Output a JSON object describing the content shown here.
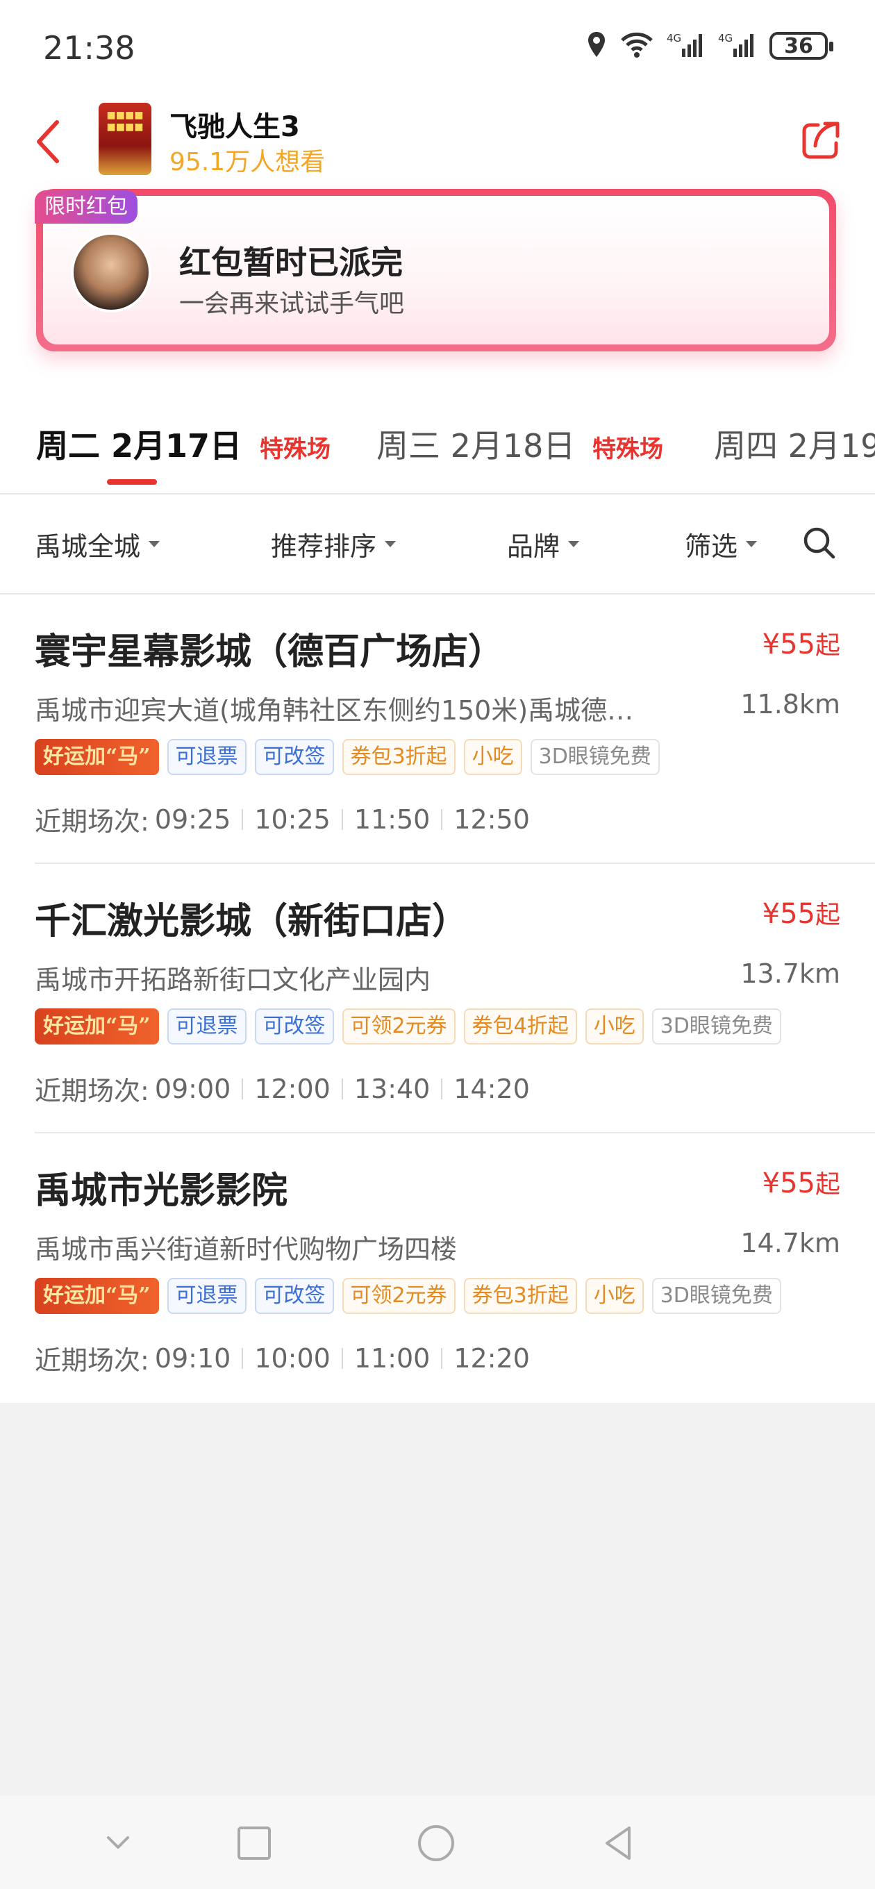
{
  "status_bar": {
    "time": "21:38",
    "battery": "36",
    "icons": [
      "location-icon",
      "wifi-icon",
      "signal-4g-icon",
      "signal-4g-icon",
      "battery-icon"
    ]
  },
  "header": {
    "movie_title": "飞驰人生3",
    "want_count": "95.1万人想看",
    "back_icon": "chevron-left-icon",
    "share_icon": "share-icon",
    "accent_color": "#e8342f"
  },
  "red_packet": {
    "tag": "限时红包",
    "title": "红包暂时已派完",
    "subtitle": "一会再来试试手气吧"
  },
  "date_tabs": [
    {
      "weekday": "周二",
      "date": "2月17日",
      "badge": "特殊场",
      "active": true
    },
    {
      "weekday": "周三",
      "date": "2月18日",
      "badge": "特殊场",
      "active": false
    },
    {
      "weekday": "周四",
      "date": "2月19",
      "badge": "",
      "active": false
    }
  ],
  "filters": {
    "area": "禹城全城",
    "sort": "推荐排序",
    "brand": "品牌",
    "filter": "筛选",
    "search_icon": "search-icon"
  },
  "cinemas": [
    {
      "name": "寰宇星幕影城（德百广场店）",
      "price": "¥55",
      "price_suffix": "起",
      "address": "禹城市迎宾大道(城角韩社区东侧约150米)禹城德…",
      "distance": "11.8km",
      "tags": [
        "好运加“马”",
        "可退票",
        "可改签",
        "券包3折起",
        "小吃",
        "3D眼镜免费"
      ],
      "showtimes_label": "近期场次:",
      "showtimes": [
        "09:25",
        "10:25",
        "11:50",
        "12:50"
      ]
    },
    {
      "name": "千汇激光影城（新街口店）",
      "price": "¥55",
      "price_suffix": "起",
      "address": "禹城市开拓路新街口文化产业园内",
      "distance": "13.7km",
      "tags": [
        "好运加“马”",
        "可退票",
        "可改签",
        "可领2元券",
        "券包4折起",
        "小吃",
        "3D眼镜免费"
      ],
      "showtimes_label": "近期场次:",
      "showtimes": [
        "09:00",
        "12:00",
        "13:40",
        "14:20"
      ]
    },
    {
      "name": "禹城市光影影院",
      "price": "¥55",
      "price_suffix": "起",
      "address": "禹城市禹兴街道新时代购物广场四楼",
      "distance": "14.7km",
      "tags": [
        "好运加“马”",
        "可退票",
        "可改签",
        "可领2元券",
        "券包3折起",
        "小吃",
        "3D眼镜免费"
      ],
      "showtimes_label": "近期场次:",
      "showtimes": [
        "09:10",
        "10:00",
        "11:00",
        "12:20"
      ]
    }
  ],
  "nav_bar": {
    "icons": [
      "chevron-down-icon",
      "square-icon",
      "circle-icon",
      "triangle-back-icon"
    ]
  }
}
